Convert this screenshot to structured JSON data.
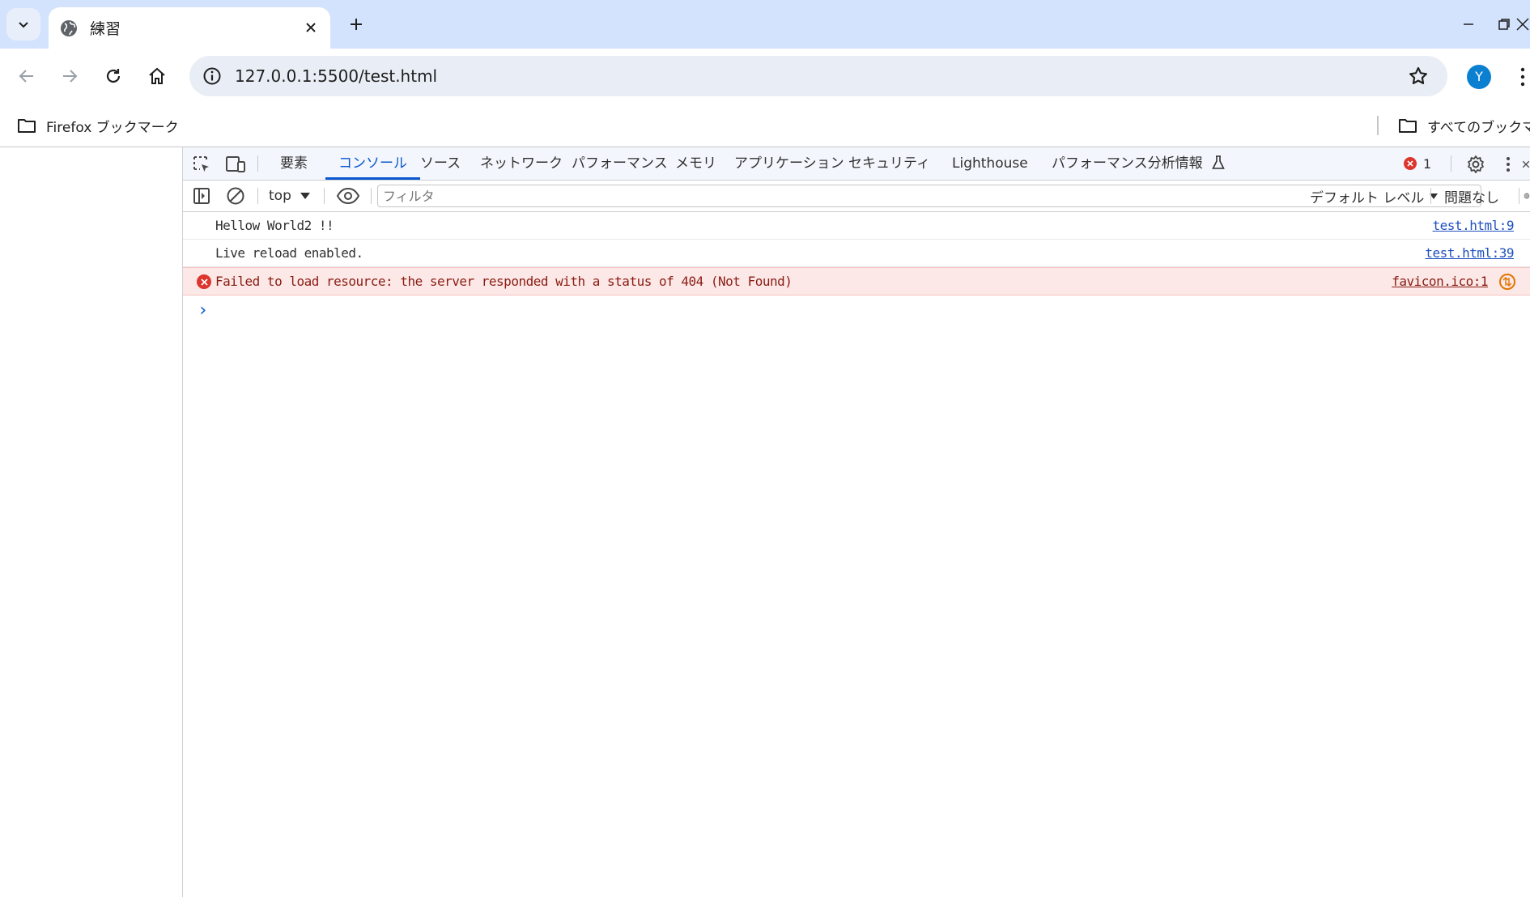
{
  "tab": {
    "title": "練習"
  },
  "address_bar": {
    "url": "127.0.0.1:5500/test.html"
  },
  "profile": {
    "initial": "Y"
  },
  "bookmarks": {
    "items": [
      {
        "label": "Firefox ブックマーク"
      },
      {
        "label": "すべてのブックマーク"
      }
    ]
  },
  "devtools": {
    "tabs": [
      {
        "label": "要素"
      },
      {
        "label": "コンソール",
        "active": true
      },
      {
        "label": "ソース"
      },
      {
        "label": "ネットワーク"
      },
      {
        "label": "パフォーマンス"
      },
      {
        "label": "メモリ"
      },
      {
        "label": "アプリケーション"
      },
      {
        "label": "セキュリティ"
      },
      {
        "label": "Lighthouse"
      },
      {
        "label": "パフォーマンス分析情報"
      }
    ],
    "error_count": "1",
    "context": "top",
    "filter_placeholder": "フィルタ",
    "levels_label": "デフォルト レベル",
    "issues_label": "問題なし",
    "messages": [
      {
        "text": "Hellow World2 !!",
        "source": "test.html:9",
        "level": "log"
      },
      {
        "text": "Live reload enabled.",
        "source": "test.html:39",
        "level": "log"
      },
      {
        "text": "Failed to load resource: the server responded with a status of 404 (Not Found)",
        "source": "favicon.ico:1",
        "level": "error"
      }
    ]
  },
  "colors": {
    "tabstrip_bg": "#d3e3fd",
    "accent": "#0b57d0",
    "error": "#dc362e",
    "error_row_bg": "#fce8e6"
  }
}
